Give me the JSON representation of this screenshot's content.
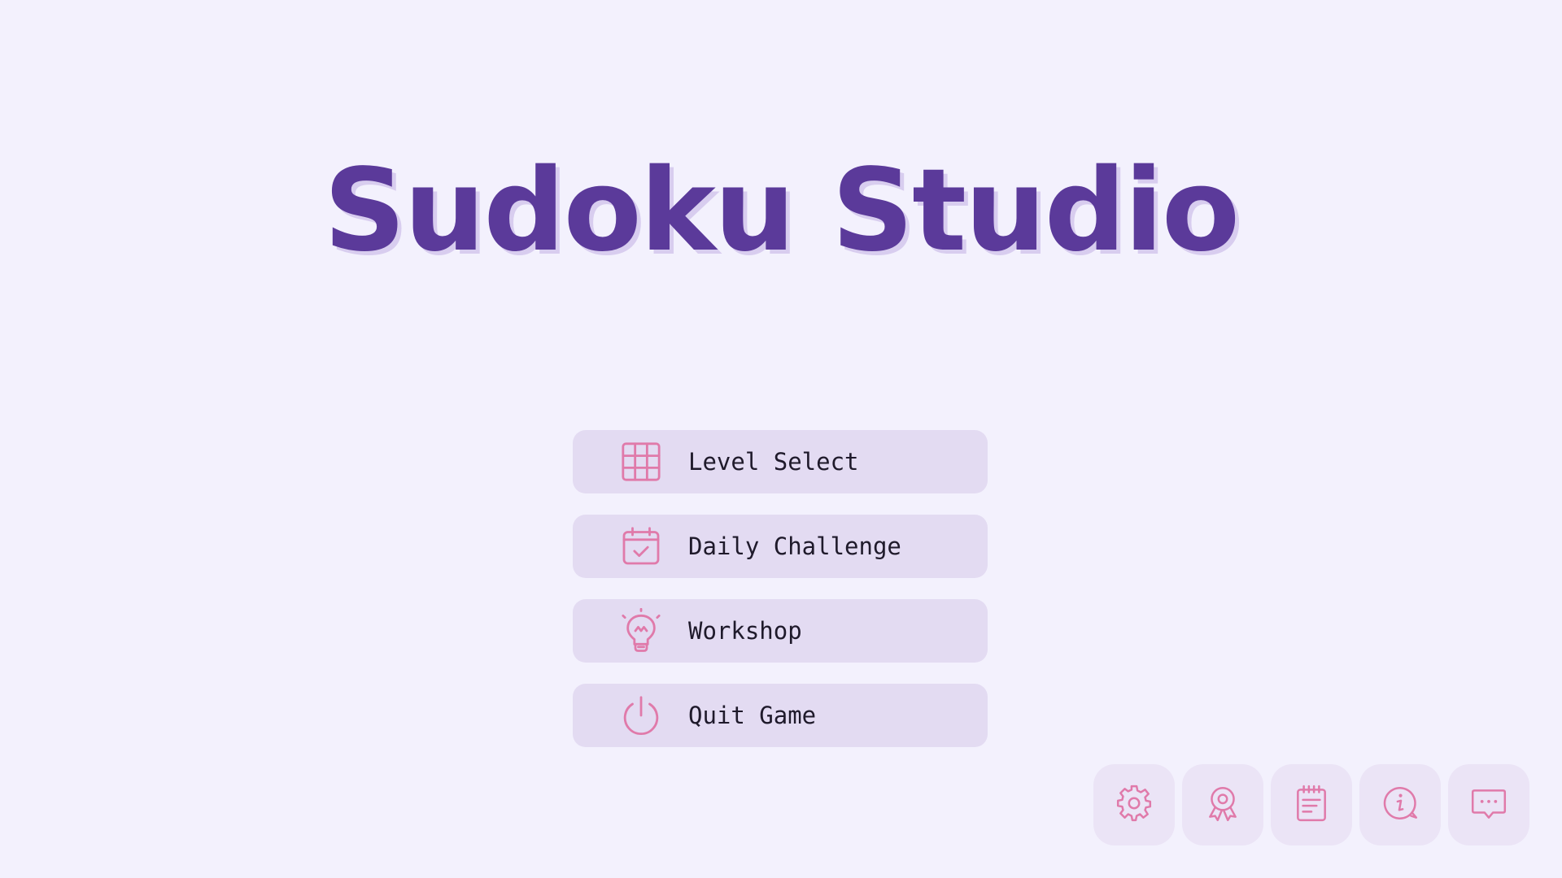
{
  "title": "Sudoku Studio",
  "colors": {
    "background": "#f3f1fd",
    "title": "#5b3a9a",
    "title_shadow": "#d8cdef",
    "button_bg": "#e3dbf2",
    "icon_accent": "#e07aaa",
    "label": "#1f1a2b"
  },
  "menu": {
    "items": [
      {
        "label": "Level Select",
        "icon": "grid-icon"
      },
      {
        "label": "Daily Challenge",
        "icon": "calendar-check-icon"
      },
      {
        "label": "Workshop",
        "icon": "lightbulb-icon"
      },
      {
        "label": "Quit Game",
        "icon": "power-icon"
      }
    ]
  },
  "corner_buttons": [
    {
      "icon": "gear-icon"
    },
    {
      "icon": "award-ribbon-icon"
    },
    {
      "icon": "notepad-icon"
    },
    {
      "icon": "info-bubble-icon"
    },
    {
      "icon": "chat-bubble-icon"
    }
  ]
}
